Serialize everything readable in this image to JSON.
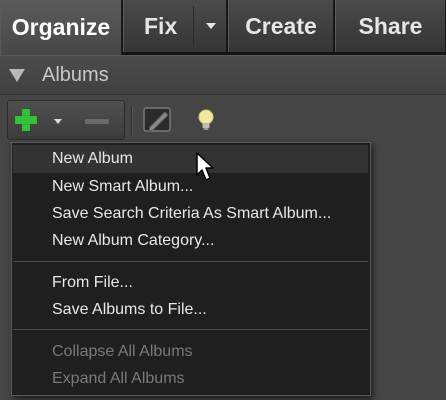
{
  "tabs": [
    {
      "label": "Organize",
      "active": true
    },
    {
      "label": "Fix",
      "has_dropdown": true
    },
    {
      "label": "Create"
    },
    {
      "label": "Share"
    }
  ],
  "panel": {
    "title": "Albums",
    "toolbar": {
      "add_icon": "plus-icon",
      "remove_icon": "minus-icon",
      "edit_icon": "edit-icon",
      "tip_icon": "lightbulb-icon"
    }
  },
  "menu": {
    "groups": [
      [
        "New Album",
        "New Smart Album...",
        "Save Search Criteria As Smart Album...",
        "New Album Category..."
      ],
      [
        "From File...",
        "Save Albums to File..."
      ],
      [
        "Collapse All Albums",
        "Expand All Albums"
      ]
    ],
    "highlighted": "New Album",
    "disabled": [
      "Collapse All Albums",
      "Expand All Albums"
    ]
  },
  "colors": {
    "accent_green": "#35c23a",
    "bulb_yellow": "#f2e9a0",
    "menu_bg": "#1f1f1f",
    "highlight_bg": "#333333"
  }
}
